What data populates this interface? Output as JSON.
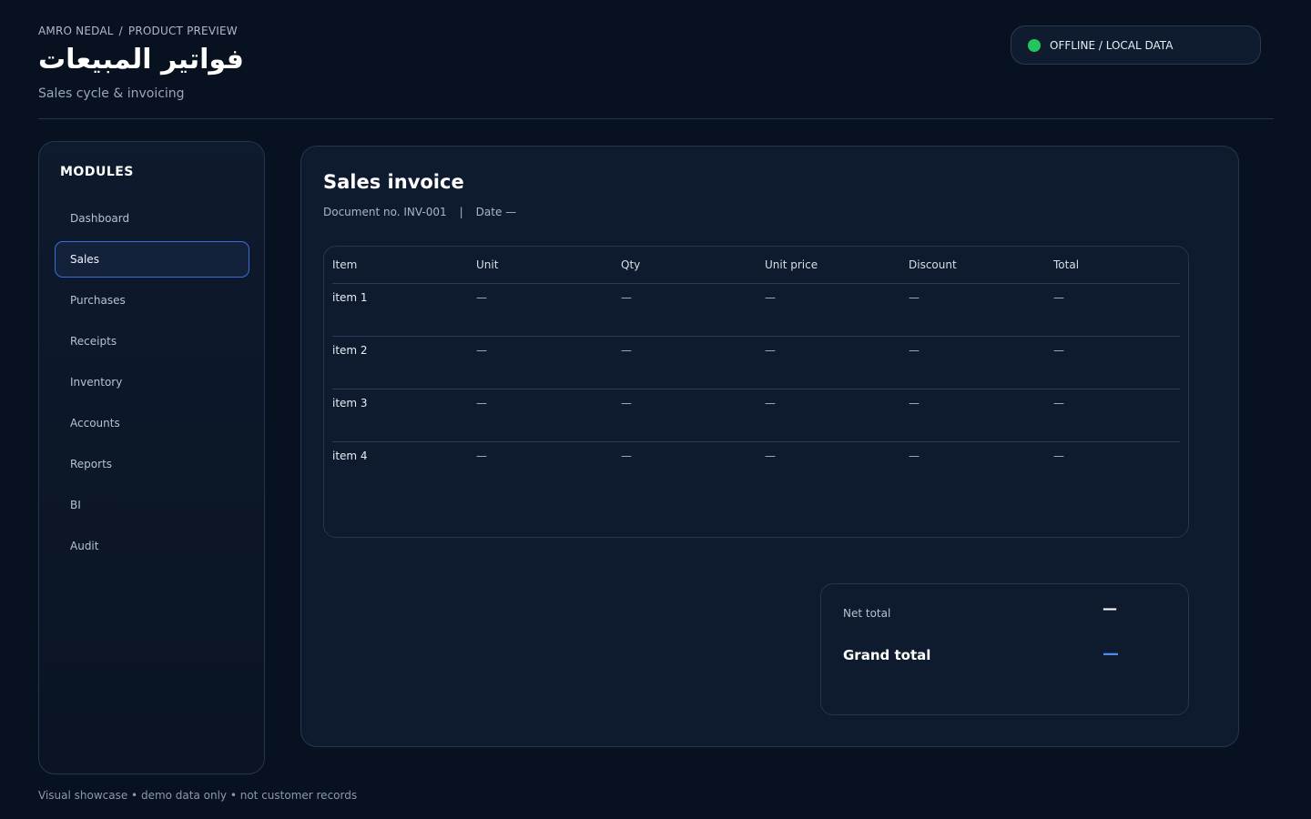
{
  "header": {
    "breadcrumb": [
      "AMRO NEDAL",
      "PRODUCT PREVIEW"
    ],
    "breadcrumb_separator": "/",
    "title": "فواتير المبيعات",
    "subtitle": "Sales cycle & invoicing",
    "status": "OFFLINE / LOCAL DATA",
    "status_color": "#22c55e"
  },
  "sidebar": {
    "heading": "MODULES",
    "items": [
      {
        "label": "Dashboard",
        "active": false
      },
      {
        "label": "Sales",
        "active": true
      },
      {
        "label": "Purchases",
        "active": false
      },
      {
        "label": "Receipts",
        "active": false
      },
      {
        "label": "Inventory",
        "active": false
      },
      {
        "label": "Accounts",
        "active": false
      },
      {
        "label": "Reports",
        "active": false
      },
      {
        "label": "BI",
        "active": false
      },
      {
        "label": "Audit",
        "active": false
      }
    ]
  },
  "invoice": {
    "title": "Sales invoice",
    "doc_label": "Document no. INV-001",
    "meta_separator": "|",
    "date_label": "Date —",
    "columns": [
      "Item",
      "Unit",
      "Qty",
      "Unit price",
      "Discount",
      "Total"
    ],
    "rows": [
      [
        "item 1",
        "—",
        "—",
        "—",
        "—",
        "—"
      ],
      [
        "item 2",
        "—",
        "—",
        "—",
        "—",
        "—"
      ],
      [
        "item 3",
        "—",
        "—",
        "—",
        "—",
        "—"
      ],
      [
        "item 4",
        "—",
        "—",
        "—",
        "—",
        "—"
      ]
    ],
    "net_total_label": "Net total",
    "net_total_value": "—",
    "grand_total_label": "Grand total",
    "grand_total_value": "—",
    "accent_color": "#4f8cf0"
  },
  "footer": "Visual showcase • demo data only • not customer records"
}
